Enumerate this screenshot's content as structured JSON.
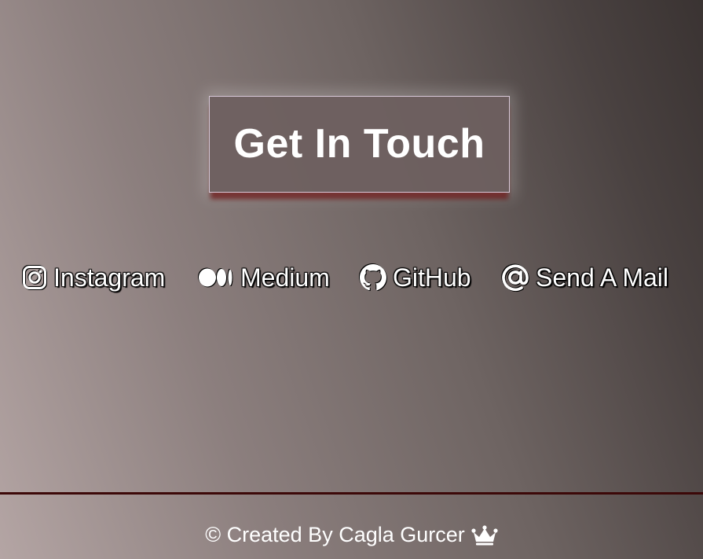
{
  "title": "Get In Touch",
  "links": [
    {
      "label": "Instagram",
      "icon": "instagram-icon"
    },
    {
      "label": "Medium",
      "icon": "medium-icon"
    },
    {
      "label": "GitHub",
      "icon": "github-icon"
    },
    {
      "label": "Send A Mail",
      "icon": "at-sign-icon"
    }
  ],
  "footer": {
    "text": "© Created By Cagla Gurcer",
    "icon": "crown-icon"
  },
  "colors": {
    "text": "#ffffff",
    "title_box_border": "#d8c8d8",
    "title_box_shadow": "#5a0000",
    "footer_border": "#3c0808"
  }
}
